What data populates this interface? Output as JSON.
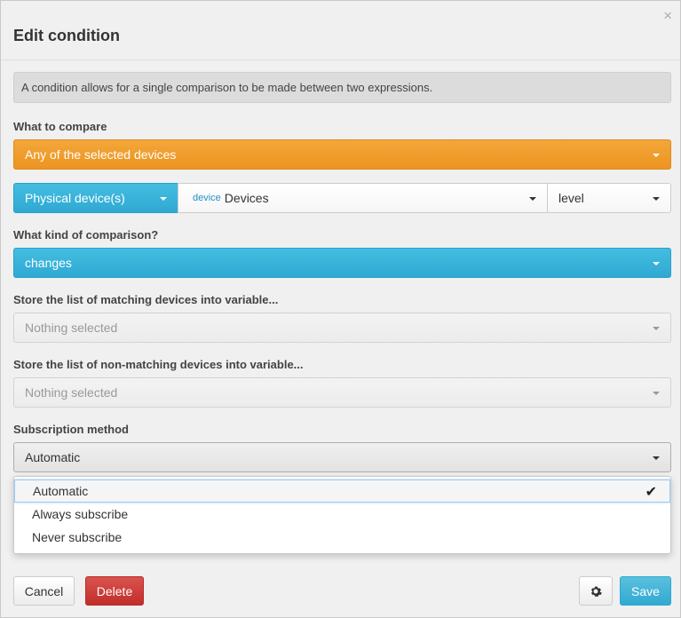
{
  "dialog": {
    "title": "Edit condition",
    "close_icon": "×",
    "description": "A condition allows for a single comparison to be made between two expressions."
  },
  "compare": {
    "label": "What to compare",
    "selection": "Any of the selected devices",
    "source_type": "Physical device(s)",
    "device_tag": "device",
    "device_value": "Devices",
    "attribute": "level"
  },
  "comparison": {
    "label": "What kind of comparison?",
    "value": "changes"
  },
  "matching_var": {
    "label": "Store the list of matching devices into variable...",
    "placeholder": "Nothing selected"
  },
  "nonmatching_var": {
    "label": "Store the list of non-matching devices into variable...",
    "placeholder": "Nothing selected"
  },
  "subscription": {
    "label": "Subscription method",
    "value": "Automatic",
    "options": [
      {
        "label": "Automatic",
        "selected": true
      },
      {
        "label": "Always subscribe",
        "selected": false
      },
      {
        "label": "Never subscribe",
        "selected": false
      }
    ],
    "check_icon": "✔"
  },
  "footer": {
    "cancel_label": "Cancel",
    "delete_label": "Delete",
    "settings_icon": "gear-icon",
    "save_label": "Save"
  },
  "colors": {
    "orange": "#ec9421",
    "blue": "#31a9d0",
    "danger": "#c9302c"
  }
}
